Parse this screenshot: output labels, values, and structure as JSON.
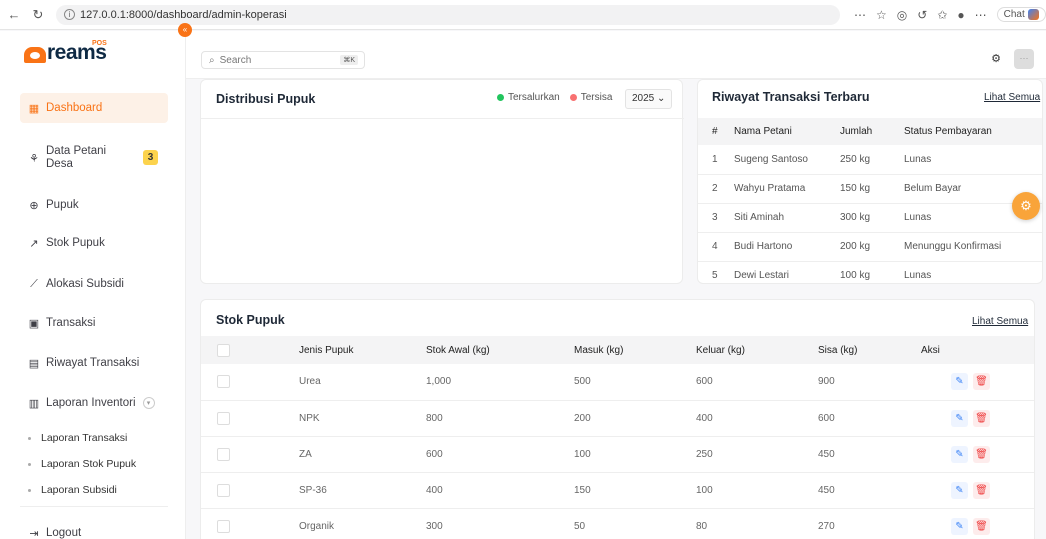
{
  "browser": {
    "url": "127.0.0.1:8000/dashboard/admin-koperasi",
    "chat_label": "Chat"
  },
  "logo": {
    "text": "reams",
    "badge": "POS"
  },
  "header": {
    "search_placeholder": "Search",
    "search_shortcut": "⌘K"
  },
  "sidebar": {
    "items": [
      {
        "label": "Dashboard",
        "icon": "grid-icon"
      },
      {
        "label": "Data Petani Desa",
        "icon": "users-icon",
        "badge": "3"
      },
      {
        "label": "Pupuk",
        "icon": "box-icon"
      },
      {
        "label": "Stok Pupuk",
        "icon": "trend-icon"
      },
      {
        "label": "Alokasi Subsidi",
        "icon": "sprout-icon"
      },
      {
        "label": "Transaksi",
        "icon": "card-icon"
      },
      {
        "label": "Riwayat Transaksi",
        "icon": "file-icon"
      },
      {
        "label": "Laporan Inventori",
        "icon": "report-icon"
      }
    ],
    "sub_items": [
      "Laporan Transaksi",
      "Laporan Stok Pupuk",
      "Laporan Subsidi"
    ],
    "logout": "Logout"
  },
  "distribusi": {
    "title": "Distribusi Pupuk",
    "legend": [
      {
        "label": "Tersalurkan",
        "color": "#22c55e"
      },
      {
        "label": "Tersisa",
        "color": "#f87171"
      }
    ],
    "year": "2025"
  },
  "riwayat": {
    "title": "Riwayat Transaksi Terbaru",
    "link": "Lihat Semua",
    "headers": [
      "#",
      "Nama Petani",
      "Jumlah",
      "Status Pembayaran"
    ],
    "rows": [
      [
        "1",
        "Sugeng Santoso",
        "250 kg",
        "Lunas"
      ],
      [
        "2",
        "Wahyu Pratama",
        "150 kg",
        "Belum Bayar"
      ],
      [
        "3",
        "Siti Aminah",
        "300 kg",
        "Lunas"
      ],
      [
        "4",
        "Budi Hartono",
        "200 kg",
        "Menunggu Konfirmasi"
      ],
      [
        "5",
        "Dewi Lestari",
        "100 kg",
        "Lunas"
      ]
    ]
  },
  "stok": {
    "title": "Stok Pupuk",
    "link": "Lihat Semua",
    "headers": [
      "Jenis Pupuk",
      "Stok Awal (kg)",
      "Masuk (kg)",
      "Keluar (kg)",
      "Sisa (kg)",
      "Aksi"
    ],
    "rows": [
      [
        "Urea",
        "1,000",
        "500",
        "600",
        "900"
      ],
      [
        "NPK",
        "800",
        "200",
        "400",
        "600"
      ],
      [
        "ZA",
        "600",
        "100",
        "250",
        "450"
      ],
      [
        "SP-36",
        "400",
        "150",
        "100",
        "450"
      ],
      [
        "Organik",
        "300",
        "50",
        "80",
        "270"
      ]
    ]
  },
  "colors": {
    "accent": "#f97316",
    "active_bg": "#fdf1e7"
  }
}
